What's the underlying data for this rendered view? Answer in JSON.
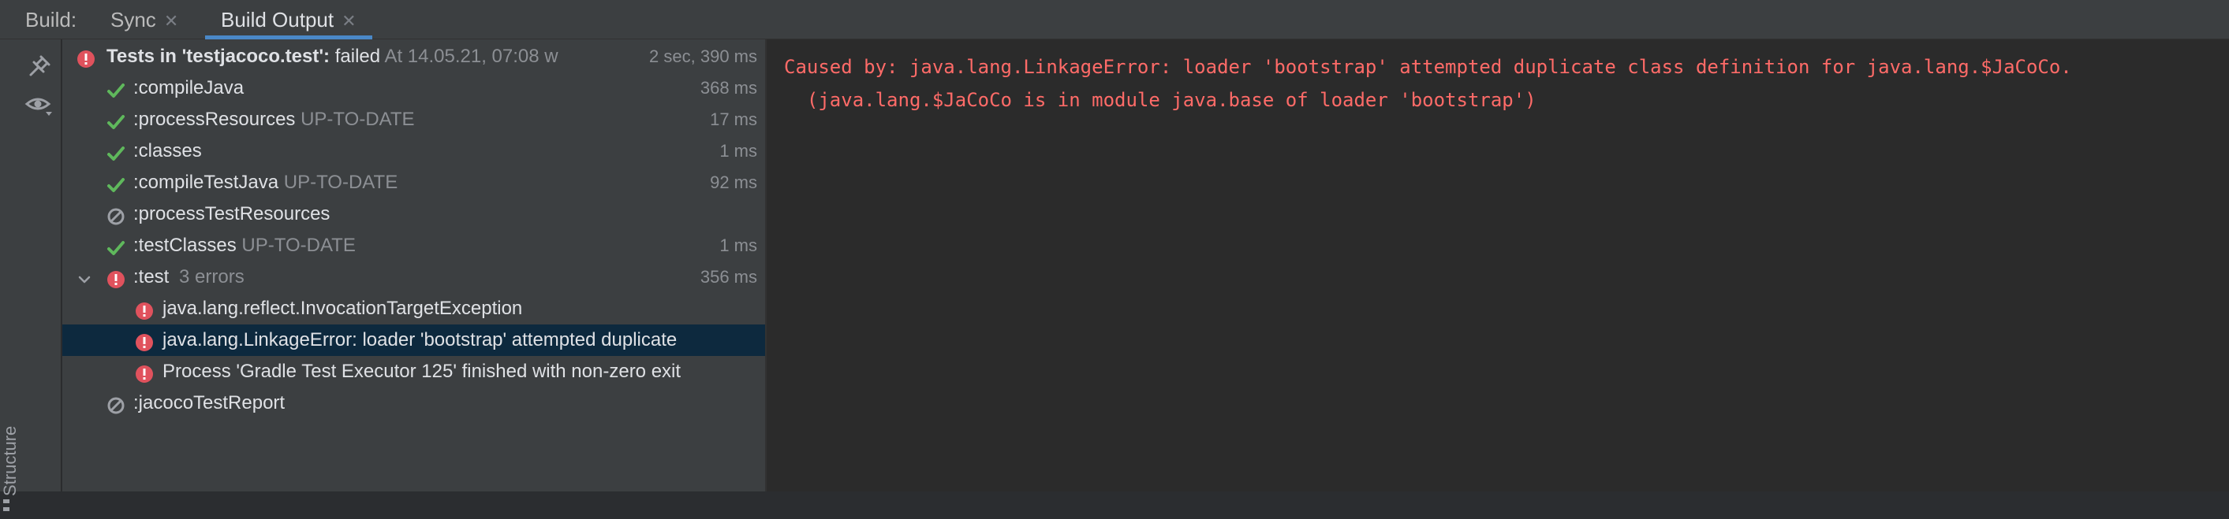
{
  "tabbar": {
    "build_label": "Build:",
    "tabs": [
      {
        "label": "Sync"
      },
      {
        "label": "Build Output"
      }
    ]
  },
  "sidebar": {
    "structure_label": "Structure"
  },
  "tree": {
    "header": {
      "title": "Tests in 'testjacoco.test':",
      "status": "failed",
      "timestamp": "At 14.05.21, 07:08 w",
      "duration": "2 sec, 390 ms"
    },
    "items": [
      {
        "label": ":compileJava",
        "suffix": "",
        "duration": "368 ms"
      },
      {
        "label": ":processResources",
        "suffix": "UP-TO-DATE",
        "duration": "17 ms"
      },
      {
        "label": ":classes",
        "suffix": "",
        "duration": "1 ms"
      },
      {
        "label": ":compileTestJava",
        "suffix": "UP-TO-DATE",
        "duration": "92 ms"
      },
      {
        "label": ":processTestResources",
        "suffix": "",
        "duration": ""
      },
      {
        "label": ":testClasses",
        "suffix": "UP-TO-DATE",
        "duration": "1 ms"
      },
      {
        "label": ":test",
        "suffix": "3 errors",
        "duration": "356 ms"
      },
      {
        "label": "java.lang.reflect.InvocationTargetException"
      },
      {
        "label": "java.lang.LinkageError: loader 'bootstrap' attempted duplicate"
      },
      {
        "label": "Process 'Gradle Test Executor 125' finished with non-zero exit"
      },
      {
        "label": ":jacocoTestReport"
      }
    ]
  },
  "console": {
    "lines": [
      "Caused by: java.lang.LinkageError: loader 'bootstrap' attempted duplicate class definition for java.lang.$JaCoCo.",
      "  (java.lang.$JaCoCo is in module java.base of loader 'bootstrap')"
    ]
  },
  "colors": {
    "success": "#5fb85c",
    "error": "#e0525d",
    "skipped": "#9da0a6",
    "selection": "#0d293e",
    "console_error": "#ff6b68",
    "tab_underline": "#4a88c7"
  }
}
